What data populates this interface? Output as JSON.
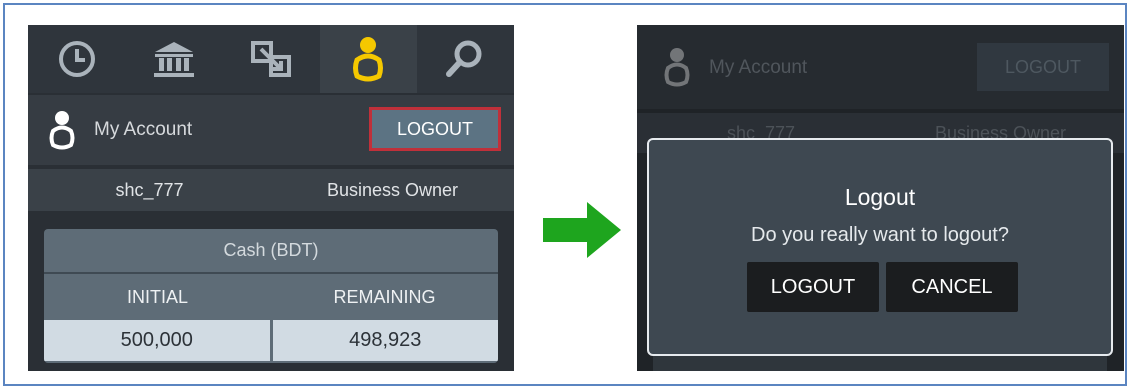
{
  "before": {
    "nav": {
      "items": [
        {
          "icon": "history-icon",
          "active": false
        },
        {
          "icon": "bank-icon",
          "active": false
        },
        {
          "icon": "transfer-icon",
          "active": false
        },
        {
          "icon": "user-icon",
          "active": true
        },
        {
          "icon": "search-icon",
          "active": false
        }
      ],
      "active_color": "#f5c800",
      "icon_color": "#aab3bb"
    },
    "account": {
      "label": "My Account",
      "logout_label": "LOGOUT",
      "highlight_color": "#c0303a"
    },
    "info": {
      "username": "shc_777",
      "role": "Business Owner"
    },
    "cash": {
      "title": "Cash (BDT)",
      "headers": [
        "INITIAL",
        "REMAINING"
      ],
      "values": [
        "500,000",
        "498,923"
      ]
    }
  },
  "arrow_color": "#1ea51e",
  "after": {
    "background": {
      "account_label": "My Account",
      "logout_label": "LOGOUT",
      "username": "shc_777",
      "role": "Business Owner"
    },
    "dialog": {
      "title": "Logout",
      "message": "Do you really want to logout?",
      "confirm_label": "LOGOUT",
      "cancel_label": "CANCEL"
    }
  }
}
